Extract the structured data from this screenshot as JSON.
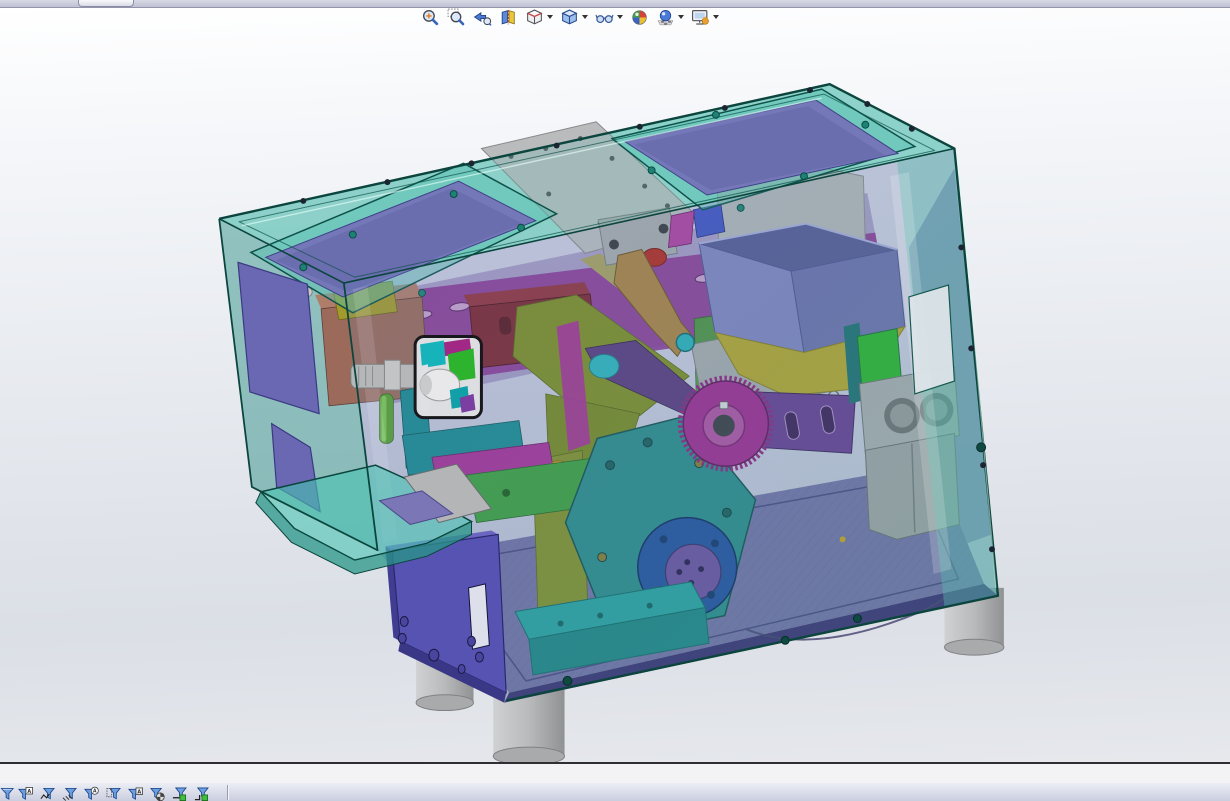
{
  "heads_up_toolbar": {
    "items": [
      {
        "id": "zoom-to-fit",
        "has_dropdown": false
      },
      {
        "id": "zoom-to-area",
        "has_dropdown": false
      },
      {
        "id": "previous-view",
        "has_dropdown": false
      },
      {
        "id": "section-view",
        "has_dropdown": false
      },
      {
        "id": "view-orientation",
        "has_dropdown": true
      },
      {
        "id": "display-style",
        "has_dropdown": true
      },
      {
        "id": "hide-show-items",
        "has_dropdown": true
      },
      {
        "id": "edit-appearance",
        "has_dropdown": false
      },
      {
        "id": "apply-scene",
        "has_dropdown": true
      },
      {
        "id": "view-settings",
        "has_dropdown": true
      }
    ]
  },
  "selection_filter_toolbar": {
    "items": [
      "clear-all-filters",
      "filter-notes",
      "filter-weld-symbols",
      "filter-surface-finish-symbols",
      "filter-balloons",
      "filter-cosmetic-threads",
      "filter-datum-targets",
      "filter-decals",
      "filter-connection-points",
      "filter-routing-points"
    ]
  },
  "viewport": {
    "model_type": "3d-assembly-shaded-with-edges",
    "housing": "transparent-teal-enclosure",
    "background_top": "#ffffff",
    "background_bottom": "#dfe2e8"
  },
  "colors": {
    "glass": "rgba(70,185,170,0.50)",
    "glass_edge": "#0b453d",
    "lid_window": "#7578b8",
    "lid_window_inner": "#6a6dae",
    "hopper": "#8184bf",
    "funnel": "#b4a42e",
    "disc": "#a02a90",
    "slotted_arm": "#6a3d92",
    "pentagon_plate": "#2c8a8a",
    "flange": "#24509e",
    "flange_hub": "#6e4fa0",
    "olive_plate": "#7f8d24",
    "dark_red_block": "#7e2731",
    "salmon_block": "#9c6a5a",
    "electronics_box": "#5753b2",
    "foot": "#bfc0c2",
    "floor": "#7470a6",
    "deck": "#8c3a94",
    "base_block": "#2aa0a0",
    "bright_teal": "#17b3bb",
    "bright_green": "#2db32d",
    "gray_part": "#b2b4b6"
  }
}
